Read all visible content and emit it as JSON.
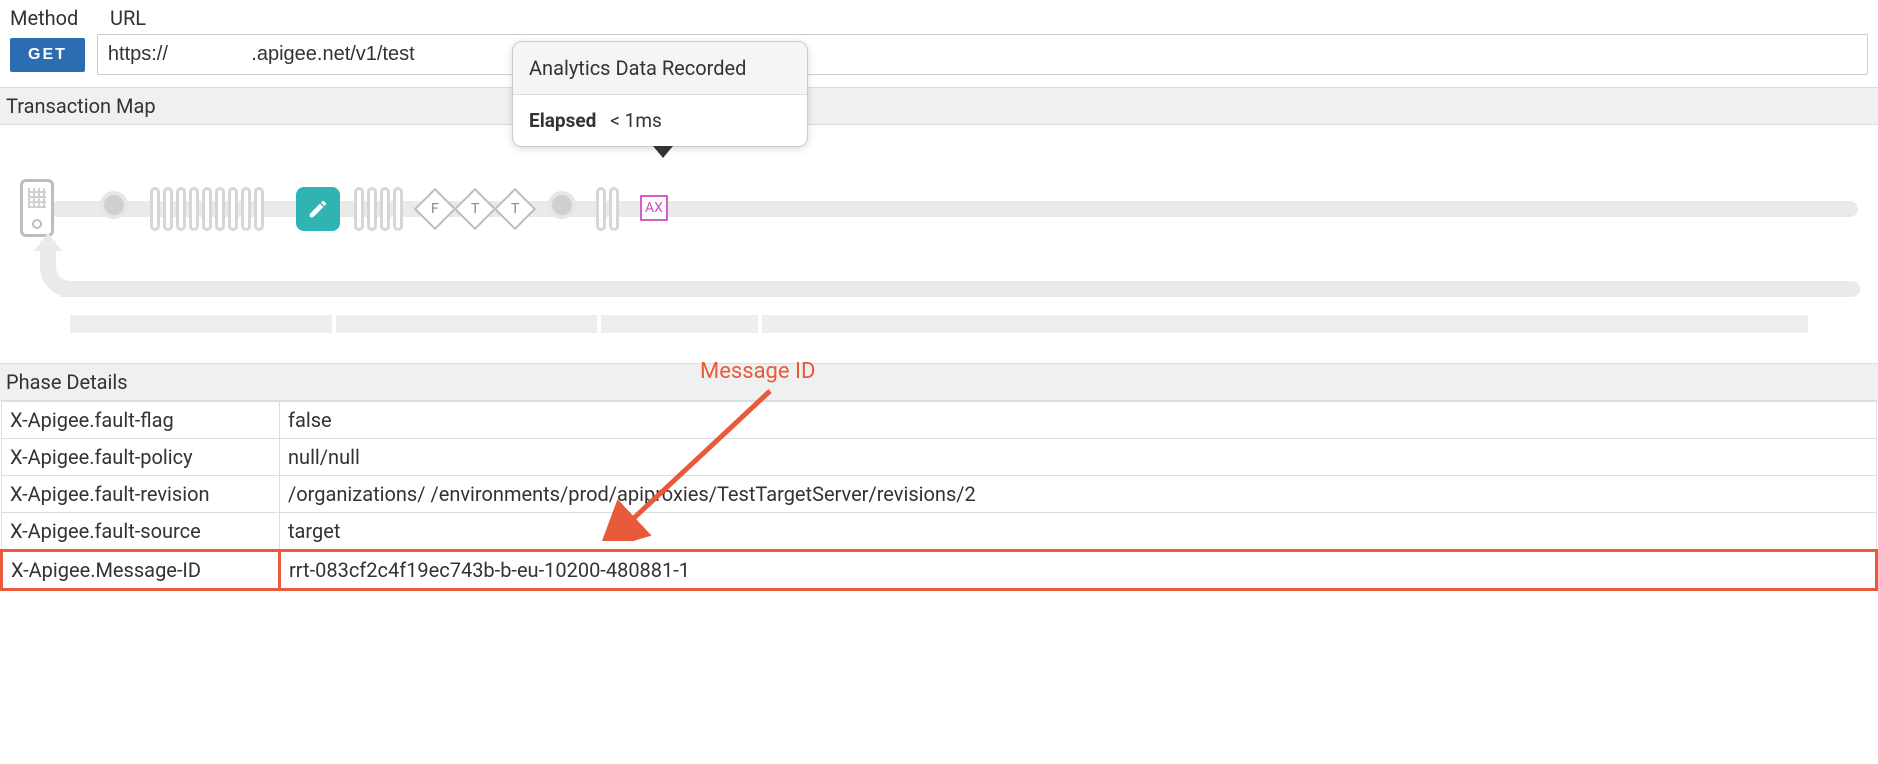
{
  "labels": {
    "method": "Method",
    "url": "URL"
  },
  "request": {
    "method": "GET",
    "url": "https://               .apigee.net/v1/test"
  },
  "sections": {
    "transaction_map": "Transaction Map",
    "phase_details": "Phase Details"
  },
  "tooltip": {
    "title": "Analytics Data Recorded",
    "elapsed_label": "Elapsed",
    "elapsed_value": "< 1ms"
  },
  "diamonds": [
    "F",
    "T",
    "T"
  ],
  "ax_label": "AX",
  "annotation": {
    "message_id": "Message ID"
  },
  "phase": {
    "rows": [
      {
        "k": "X-Apigee.fault-flag",
        "v": "false"
      },
      {
        "k": "X-Apigee.fault-policy",
        "v": "null/null"
      },
      {
        "k": "X-Apigee.fault-revision",
        "v": "/organizations/            /environments/prod/apiproxies/TestTargetServer/revisions/2"
      },
      {
        "k": "X-Apigee.fault-source",
        "v": "target"
      },
      {
        "k": "X-Apigee.Message-ID",
        "v": "rrt-083cf2c4f19ec743b-b-eu-10200-480881-1"
      }
    ]
  }
}
